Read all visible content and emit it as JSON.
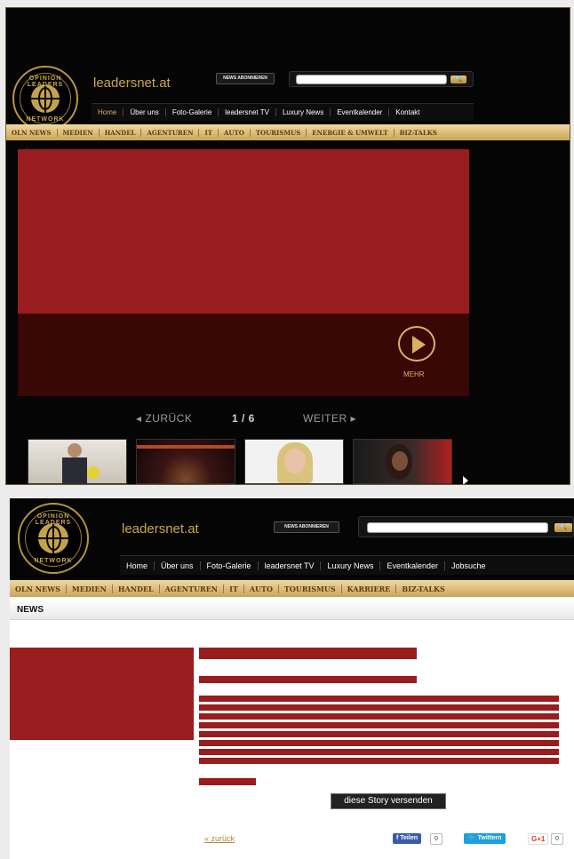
{
  "site": {
    "name": "leadersnet.at",
    "logo_top": "OPINION LEADERS",
    "logo_bottom": "NETWORK",
    "news_button": "NEWS ABONNIEREN",
    "search_button": "🔍"
  },
  "panel1": {
    "main_nav": [
      "Home",
      "Über uns",
      "Foto-Galerie",
      "leadersnet TV",
      "Luxury News",
      "Eventkalender",
      "Kontakt"
    ],
    "sub_nav": [
      "OLN NEWS",
      "MEDIEN",
      "HANDEL",
      "AGENTUREN",
      "IT",
      "AUTO",
      "TOURISMUS",
      "ENERGIE & UMWELT",
      "BIZ-TALKS"
    ],
    "slider": {
      "more_label": "MEHR",
      "prev_label": "◂ ZURÜCK",
      "counter": "1 / 6",
      "next_label": "WEITER ▸"
    }
  },
  "panel2": {
    "main_nav": [
      "Home",
      "Über uns",
      "Foto-Galerie",
      "leadersnet TV",
      "Luxury News",
      "Eventkalender",
      "Jobsuche"
    ],
    "sub_nav": [
      "OLN NEWS",
      "MEDIEN",
      "HANDEL",
      "AGENTUREN",
      "IT",
      "AUTO",
      "TOURISMUS",
      "KARRIERE",
      "BIZ-TALKS"
    ],
    "section_label": "NEWS",
    "send_story": "diese Story versenden",
    "back_link": "« zurück",
    "share": {
      "facebook": "f Teilen",
      "facebook_count": "0",
      "twitter": "🐦 Twittern",
      "gplus": "G+1",
      "gplus_count": "0"
    }
  },
  "colors": {
    "accent_gold": "#c9a84a",
    "placeholder_red": "#991c1f",
    "header_bg": "#050505"
  }
}
